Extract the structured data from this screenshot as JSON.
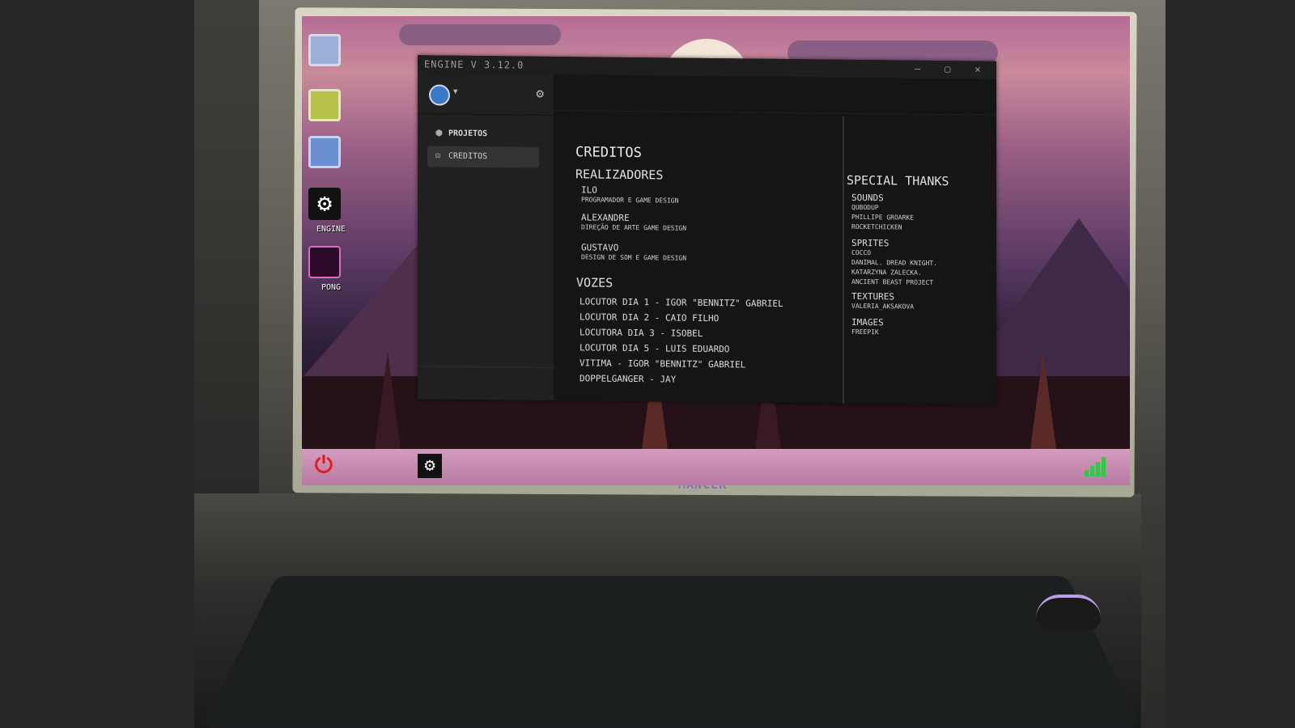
{
  "desktop": {
    "icons": [
      {
        "name": "monitor-icon",
        "label": ""
      },
      {
        "name": "chest-icon",
        "label": ""
      },
      {
        "name": "folder-icon",
        "label": ""
      },
      {
        "name": "engine-gear-icon",
        "label": "ENGINE"
      },
      {
        "name": "pong-icon",
        "label": "PONG"
      }
    ],
    "brand": "MANCER"
  },
  "window": {
    "title": "ENGINE V 3.12.0",
    "controls": {
      "minimize": "–",
      "maximize": "▢",
      "close": "✕"
    }
  },
  "sidebar": {
    "items": [
      {
        "label": "PROJETOS",
        "icon": "cube-icon"
      },
      {
        "label": "CREDITOS",
        "icon": "lock-icon"
      }
    ]
  },
  "credits": {
    "title": "CREDITOS",
    "realizadores_heading": "REALIZADORES",
    "realizadores": [
      {
        "name": "ILO",
        "role": "PROGRAMADOR E GAME DESIGN"
      },
      {
        "name": "ALEXANDRE",
        "role": "DIREÇÃO DE ARTE GAME DESIGN"
      },
      {
        "name": "GUSTAVO",
        "role": "DESIGN DE SOM E GAME DESIGN"
      }
    ],
    "vozes_heading": "VOZES",
    "vozes": [
      "LOCUTOR DIA 1 - IGOR \"BENNITZ\" GABRIEL",
      "LOCUTOR DIA 2 - CAIO FILHO",
      "LOCUTORA DIA 3 - ISOBEL",
      "LOCUTOR DIA 5 - LUIS EDUARDO",
      "VITIMA - IGOR \"BENNITZ\" GABRIEL",
      "DOPPELGANGER - JAY"
    ],
    "special_thanks_heading": "SPECIAL THANKS",
    "special_thanks": [
      {
        "heading": "SOUNDS",
        "items": [
          "QUBODUP",
          "PHILLIPE GROARKE",
          "ROCKETCHICKEN"
        ]
      },
      {
        "heading": "SPRITES",
        "items": [
          "COCCO",
          "DANIMAL. DREAD KNIGHT.",
          "KATARZYNA ZALECKA.",
          "ANCIENT BEAST PROJECT"
        ]
      },
      {
        "heading": "TEXTURES",
        "items": [
          "VALERIA_AKSAKOVA"
        ]
      },
      {
        "heading": "IMAGES",
        "items": [
          "FREEPIK"
        ]
      }
    ]
  },
  "colors": {
    "accent_power": "#e0201e",
    "signal": "#1fd43a",
    "taskbar": "#c98ab2"
  }
}
